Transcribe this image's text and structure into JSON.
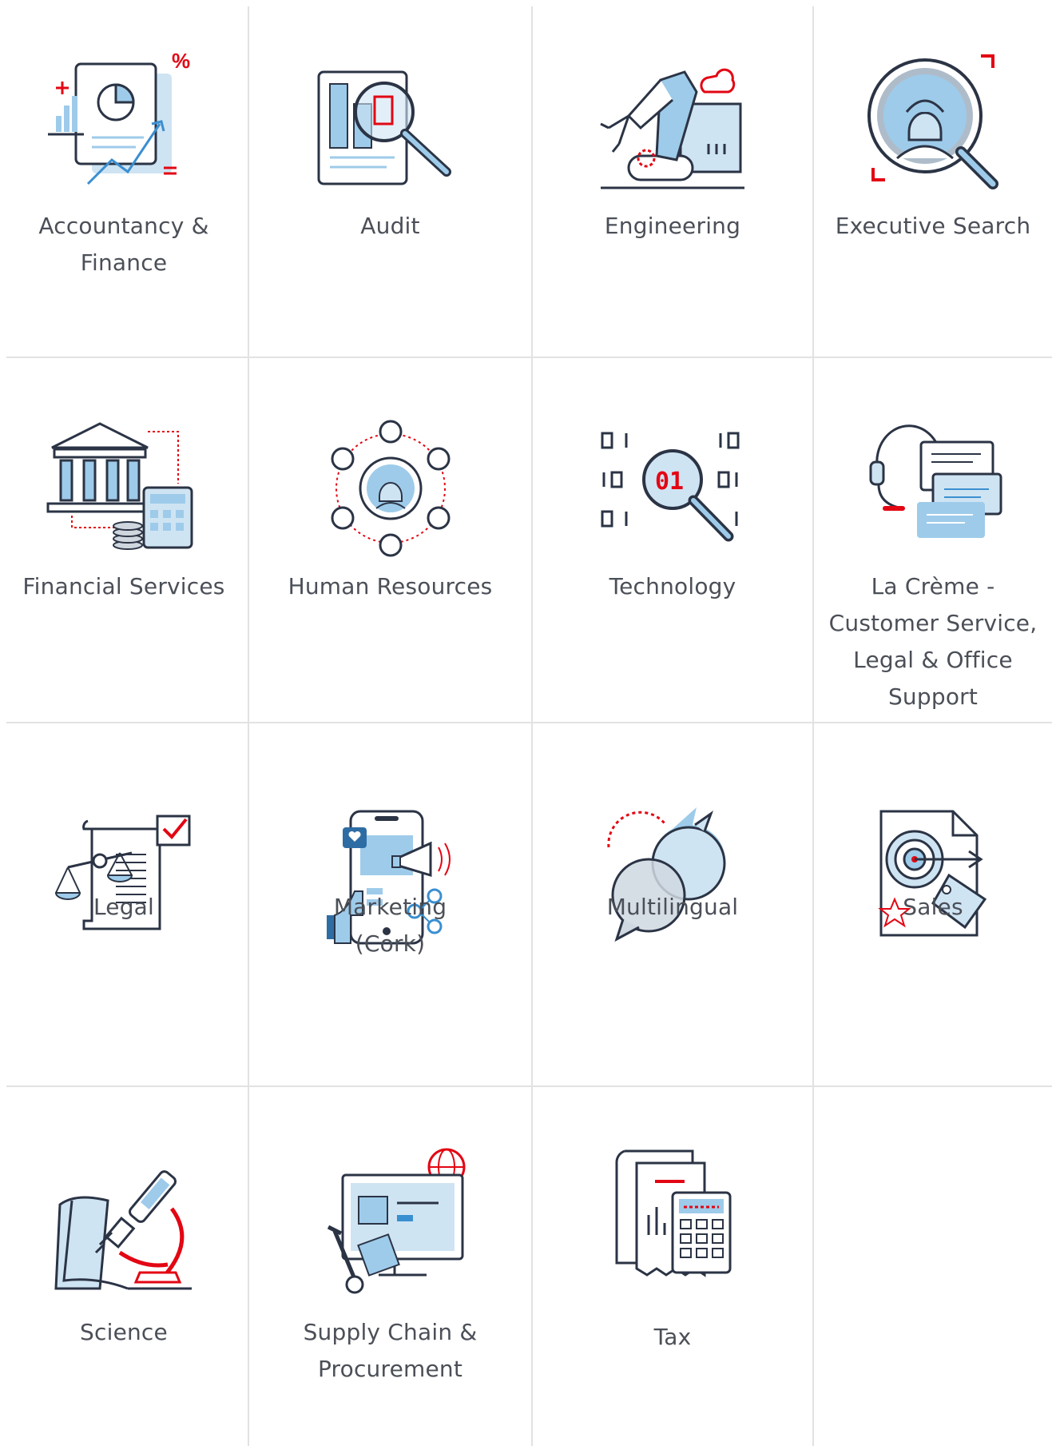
{
  "colors": {
    "navy": "#2b3445",
    "blue": "#9ecbea",
    "lightblue": "#cfe4f3",
    "red": "#e30613",
    "grid": "#e2e2e2",
    "text": "#4b4f57"
  },
  "sectors": [
    {
      "label": "Accountancy &\nFinance",
      "icon": "finance-chart-icon"
    },
    {
      "label": "Audit",
      "icon": "audit-magnifier-icon"
    },
    {
      "label": "Engineering",
      "icon": "robot-arm-factory-icon"
    },
    {
      "label": "Executive Search",
      "icon": "person-search-icon"
    },
    {
      "label": "Financial Services",
      "icon": "bank-calculator-icon"
    },
    {
      "label": "Human Resources",
      "icon": "people-network-icon"
    },
    {
      "label": "Technology",
      "icon": "binary-magnifier-icon"
    },
    {
      "label": "La Crème -\nCustomer Service,\nLegal & Office\nSupport",
      "icon": "headset-chat-icon"
    },
    {
      "label": "Legal",
      "icon": "scales-document-icon"
    },
    {
      "label": "Marketing\n(Cork)",
      "icon": "phone-megaphone-icon"
    },
    {
      "label": "Multilingual",
      "icon": "speech-bubbles-icon"
    },
    {
      "label": "Sales",
      "icon": "target-tag-icon"
    },
    {
      "label": "Science",
      "icon": "microscope-icon"
    },
    {
      "label": "Supply Chain &\nProcurement",
      "icon": "monitor-trolley-icon"
    },
    {
      "label": "Tax",
      "icon": "calculator-receipts-icon"
    }
  ]
}
